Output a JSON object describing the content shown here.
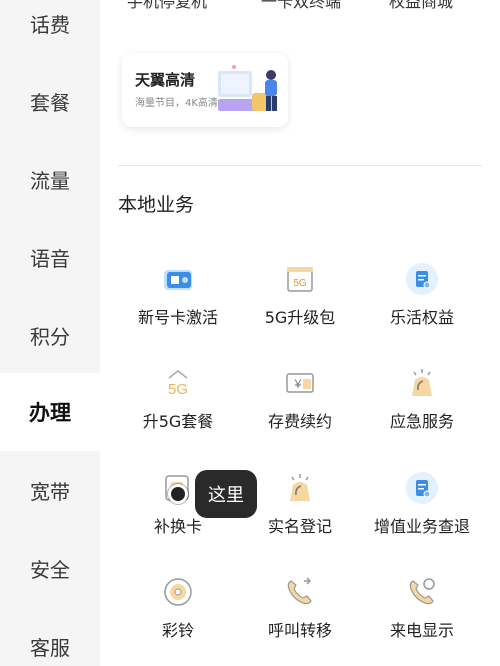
{
  "sidebar": {
    "items": [
      {
        "label": "话费"
      },
      {
        "label": "套餐"
      },
      {
        "label": "流量"
      },
      {
        "label": "语音"
      },
      {
        "label": "积分"
      },
      {
        "label": "办理"
      },
      {
        "label": "宽带"
      },
      {
        "label": "安全"
      },
      {
        "label": "客服"
      }
    ],
    "active": "办理"
  },
  "top_row": [
    "手机停复机",
    "一卡双终端",
    "权益商城"
  ],
  "banner": {
    "title": "天翼高清",
    "subtitle": "海量节目，4K高清"
  },
  "section": {
    "title": "本地业务"
  },
  "services": [
    {
      "label": "新号卡激活",
      "icon": "sim-card-icon"
    },
    {
      "label": "5G升级包",
      "icon": "5g-gift-icon"
    },
    {
      "label": "乐活权益",
      "icon": "document-badge-icon"
    },
    {
      "label": "升5G套餐",
      "icon": "5g-upgrade-icon"
    },
    {
      "label": "存费续约",
      "icon": "yuan-card-icon"
    },
    {
      "label": "应急服务",
      "icon": "emergency-phone-icon"
    },
    {
      "label": "补换卡",
      "icon": "sim-replace-icon"
    },
    {
      "label": "实名登记",
      "icon": "id-register-icon"
    },
    {
      "label": "增值业务查退",
      "icon": "value-added-icon"
    },
    {
      "label": "彩铃",
      "icon": "ringtone-disc-icon"
    },
    {
      "label": "呼叫转移",
      "icon": "call-forward-icon"
    },
    {
      "label": "来电显示",
      "icon": "caller-id-icon"
    }
  ],
  "tooltip": {
    "text": "这里"
  },
  "colors": {
    "accent": "#3a8ee6",
    "icon_gold": "#e8b45a",
    "sidebar_bg": "#f5f5f5"
  }
}
